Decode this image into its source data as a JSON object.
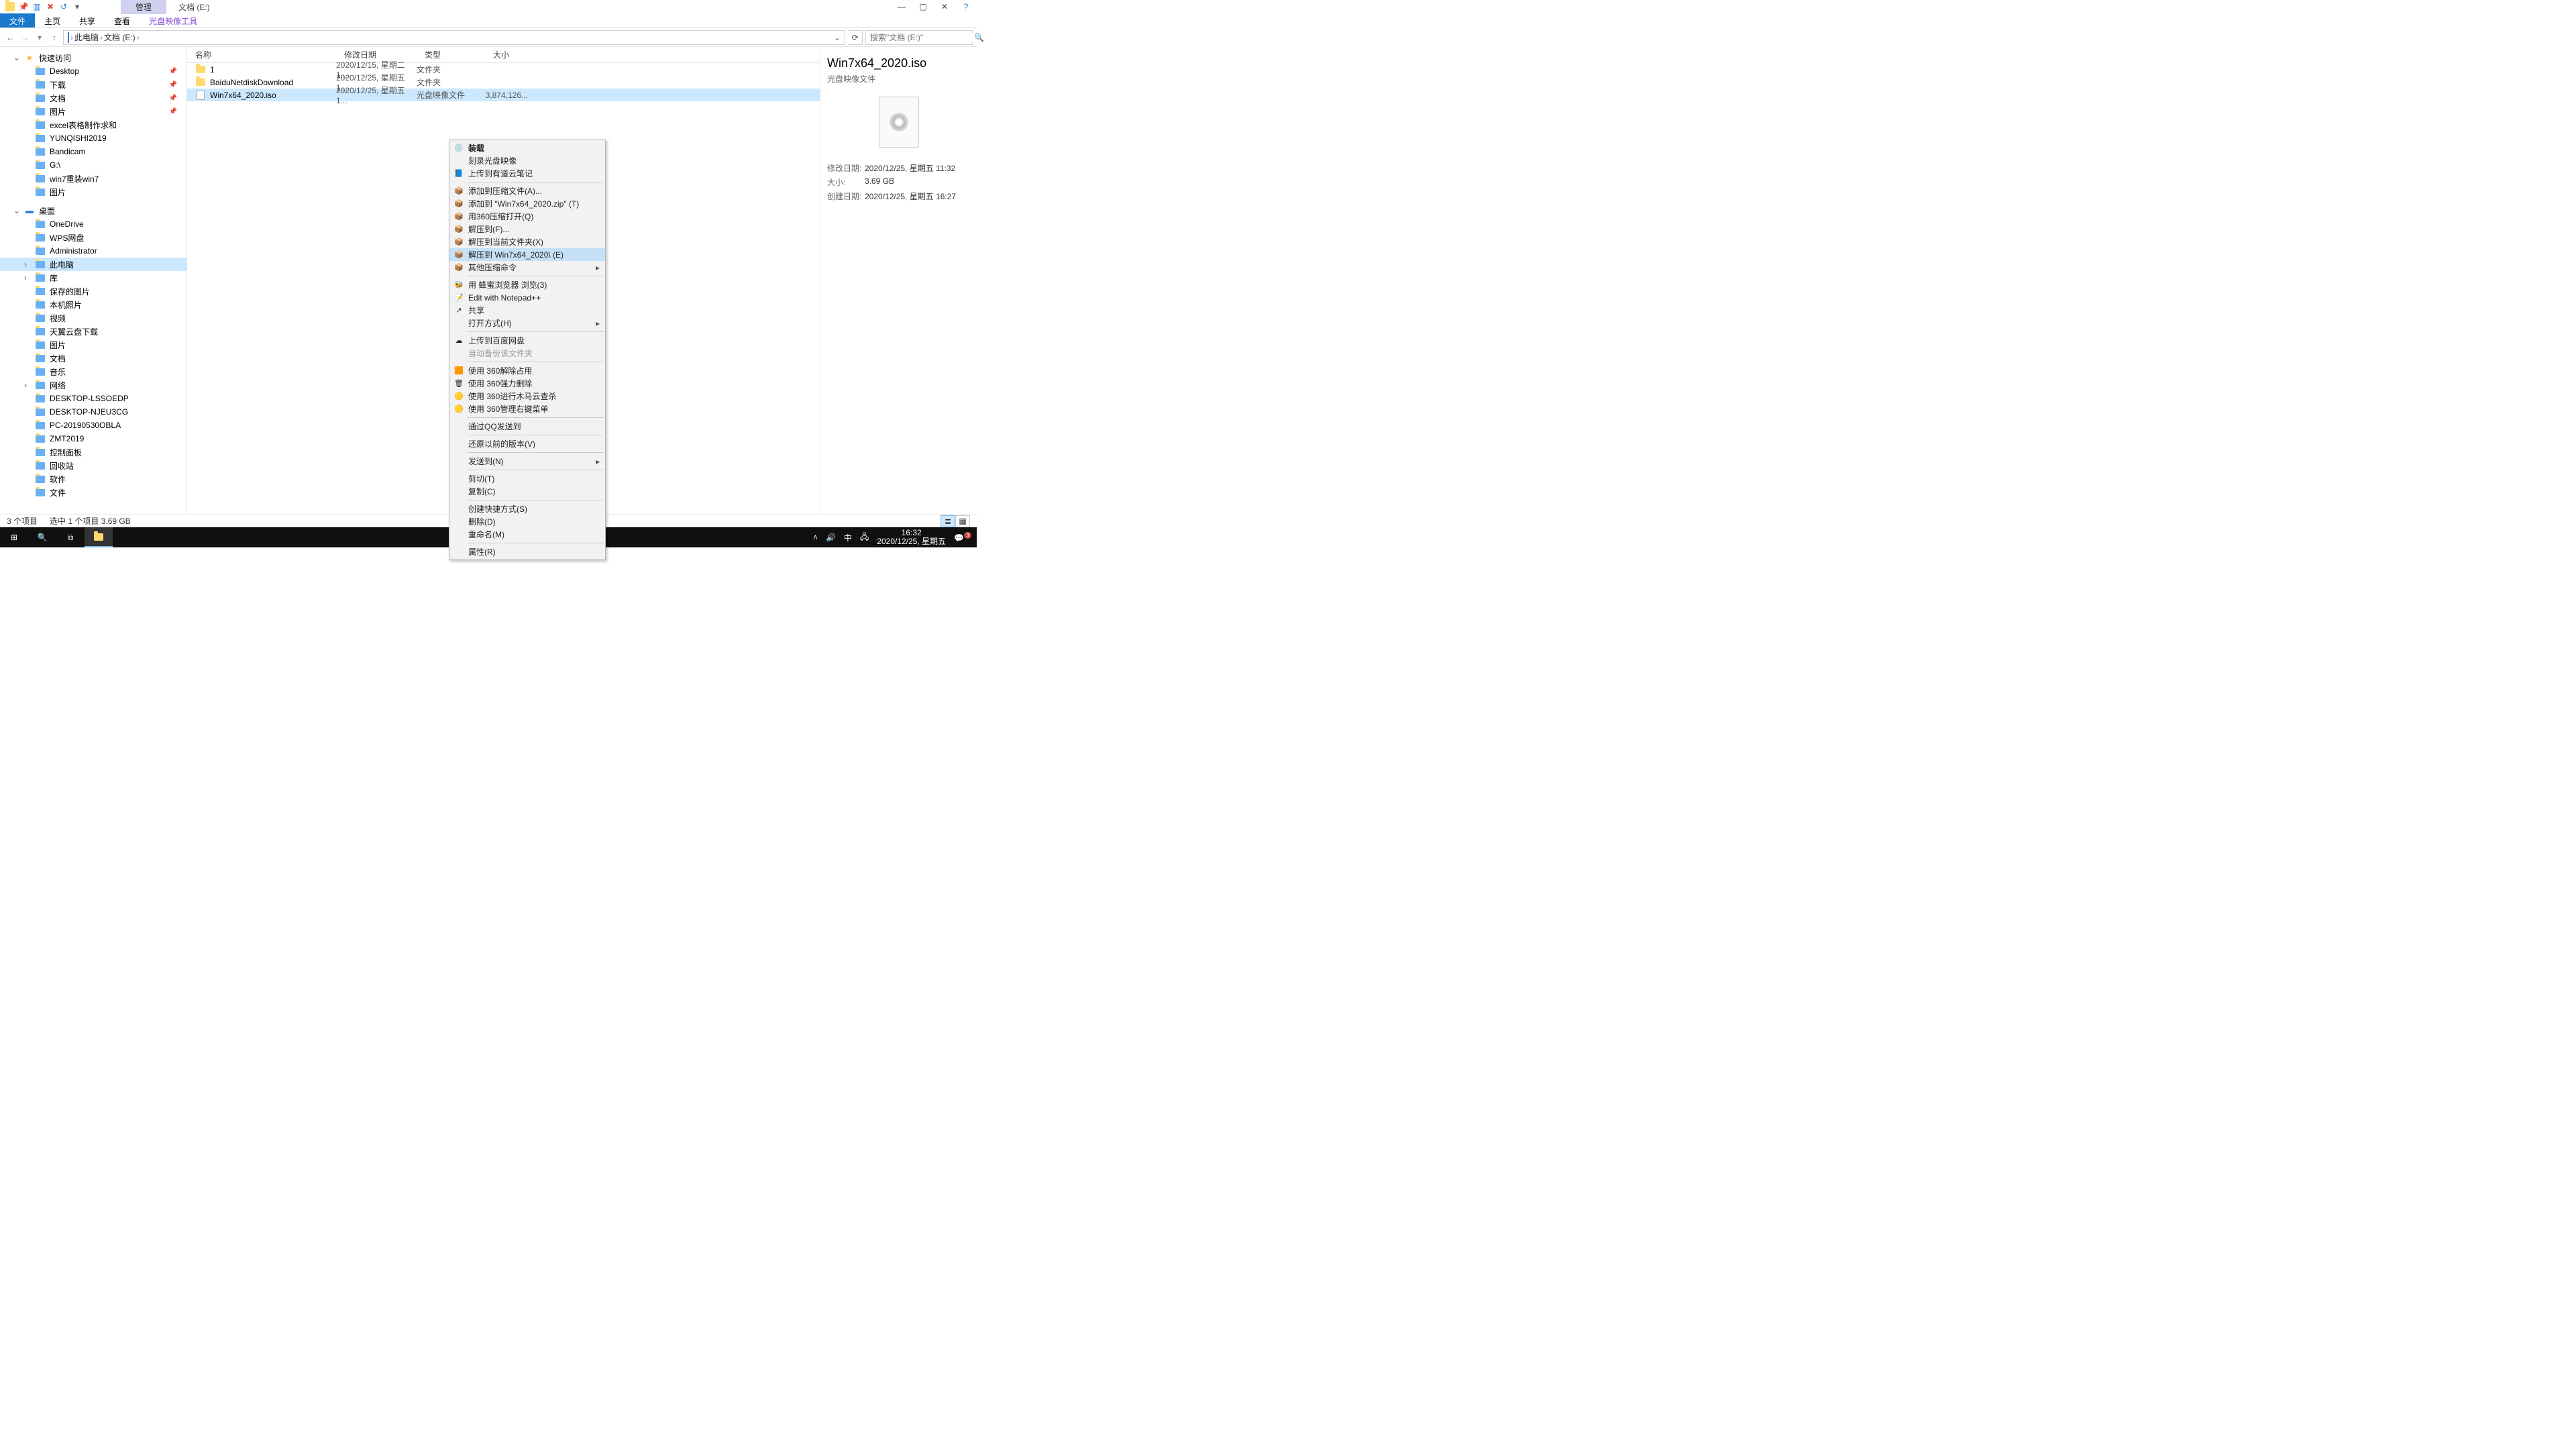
{
  "window": {
    "title": "文档 (E:)",
    "ctx_tab": "管理"
  },
  "ribbon": {
    "file": "文件",
    "home": "主页",
    "share": "共享",
    "view": "查看",
    "tool": "光盘映像工具"
  },
  "addr": {
    "pc": "此电脑",
    "loc": "文档 (E:)",
    "search_ph": "搜索\"文档 (E:)\""
  },
  "nav": {
    "quick": "快速访问",
    "quick_items": [
      "Desktop",
      "下载",
      "文档",
      "图片",
      "excel表格制作求和",
      "YUNQISHI2019",
      "Bandicam",
      "G:\\",
      "win7重装win7",
      "图片"
    ],
    "desktop": "桌面",
    "desktop_items": [
      "OneDrive",
      "WPS网盘",
      "Administrator",
      "此电脑",
      "库",
      "保存的图片",
      "本机照片",
      "视频",
      "天翼云盘下载",
      "图片",
      "文档",
      "音乐",
      "网络",
      "DESKTOP-LSSOEDP",
      "DESKTOP-NJEU3CG",
      "PC-20190530OBLA",
      "ZMT2019",
      "控制面板",
      "回收站",
      "软件",
      "文件"
    ]
  },
  "cols": {
    "name": "名称",
    "date": "修改日期",
    "type": "类型",
    "size": "大小"
  },
  "rows": [
    {
      "name": "1",
      "date": "2020/12/15, 星期二 1...",
      "type": "文件夹",
      "size": "",
      "folder": true
    },
    {
      "name": "BaiduNetdiskDownload",
      "date": "2020/12/25, 星期五 1...",
      "type": "文件夹",
      "size": "",
      "folder": true
    },
    {
      "name": "Win7x64_2020.iso",
      "date": "2020/12/25, 星期五 1...",
      "type": "光盘映像文件",
      "size": "3,874,126...",
      "folder": false,
      "sel": true
    }
  ],
  "ctx": [
    {
      "t": "装载",
      "bold": true,
      "ico": "💿"
    },
    {
      "t": "刻录光盘映像"
    },
    {
      "t": "上传到有道云笔记",
      "ico": "📘"
    },
    {
      "sep": true
    },
    {
      "t": "添加到压缩文件(A)...",
      "ico": "📦"
    },
    {
      "t": "添加到 \"Win7x64_2020.zip\" (T)",
      "ico": "📦"
    },
    {
      "t": "用360压缩打开(Q)",
      "ico": "📦"
    },
    {
      "t": "解压到(F)...",
      "ico": "📦"
    },
    {
      "t": "解压到当前文件夹(X)",
      "ico": "📦"
    },
    {
      "t": "解压到 Win7x64_2020\\ (E)",
      "ico": "📦",
      "hl": true
    },
    {
      "t": "其他压缩命令",
      "ico": "📦",
      "sub": true
    },
    {
      "sep": true
    },
    {
      "t": "用 蜂蜜浏览器 浏览(3)",
      "ico": "🐝"
    },
    {
      "t": "Edit with Notepad++",
      "ico": "📝"
    },
    {
      "t": "共享",
      "ico": "↗"
    },
    {
      "t": "打开方式(H)",
      "sub": true
    },
    {
      "sep": true
    },
    {
      "t": "上传到百度网盘",
      "ico": "☁"
    },
    {
      "t": "自动备份该文件夹",
      "dis": true
    },
    {
      "sep": true
    },
    {
      "t": "使用 360解除占用",
      "ico": "🟧"
    },
    {
      "t": "使用 360强力删除",
      "ico": "🗑"
    },
    {
      "t": "使用 360进行木马云查杀",
      "ico": "🟡"
    },
    {
      "t": "使用 360管理右键菜单",
      "ico": "🟡"
    },
    {
      "sep": true
    },
    {
      "t": "通过QQ发送到"
    },
    {
      "sep": true
    },
    {
      "t": "还原以前的版本(V)"
    },
    {
      "sep": true
    },
    {
      "t": "发送到(N)",
      "sub": true
    },
    {
      "sep": true
    },
    {
      "t": "剪切(T)"
    },
    {
      "t": "复制(C)"
    },
    {
      "sep": true
    },
    {
      "t": "创建快捷方式(S)"
    },
    {
      "t": "删除(D)"
    },
    {
      "t": "重命名(M)"
    },
    {
      "sep": true
    },
    {
      "t": "属性(R)"
    }
  ],
  "preview": {
    "title": "Win7x64_2020.iso",
    "sub": "光盘映像文件",
    "k_mod": "修改日期:",
    "v_mod": "2020/12/25, 星期五 11:32",
    "k_size": "大小:",
    "v_size": "3.69 GB",
    "k_cre": "创建日期:",
    "v_cre": "2020/12/25, 星期五 16:27"
  },
  "status": {
    "count": "3 个项目",
    "sel": "选中 1 个项目  3.69 GB"
  },
  "tray": {
    "ime": "中",
    "time": "16:32",
    "date": "2020/12/25, 星期五",
    "badge": "3"
  }
}
